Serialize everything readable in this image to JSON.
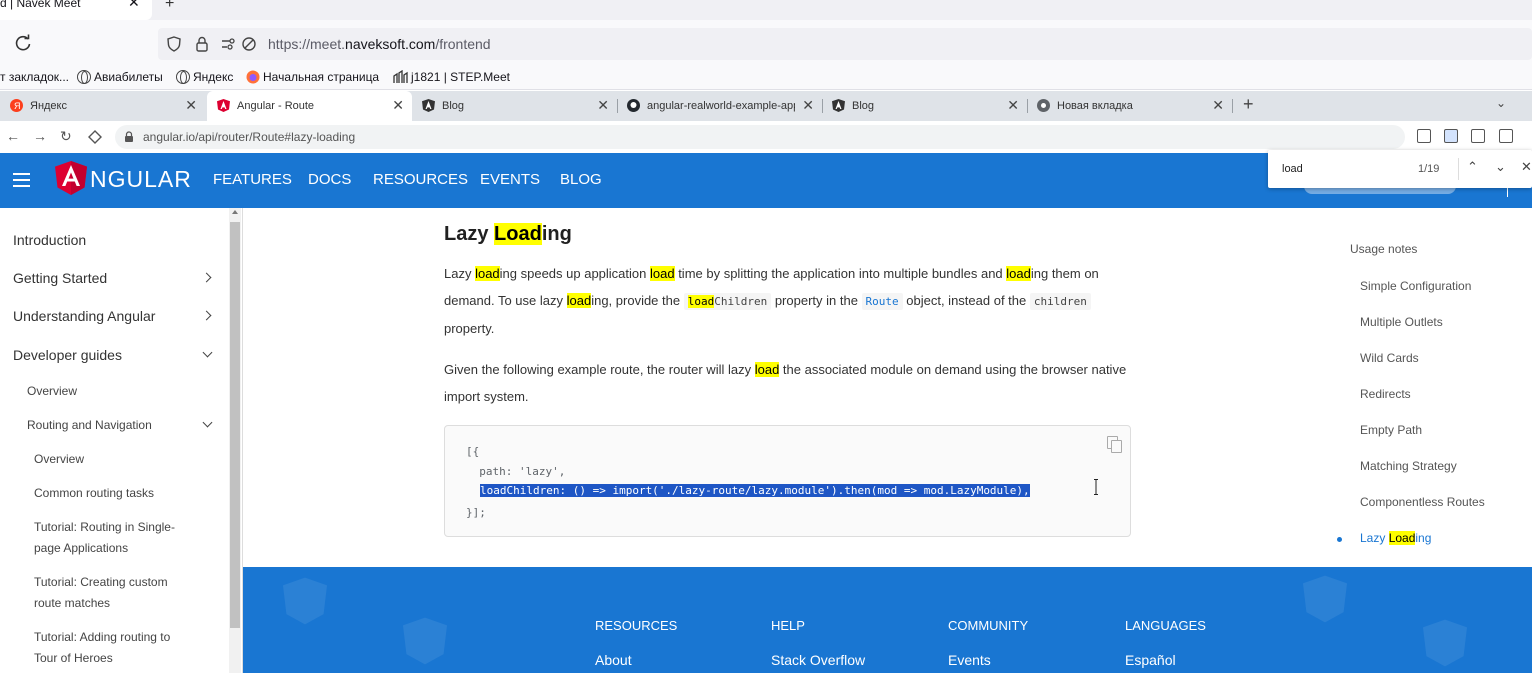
{
  "outer_browser": {
    "tab_title": "d | Navek Meet",
    "close_glyph": "✕",
    "new_tab_glyph": "+",
    "url_prefix": "https://meet.",
    "url_domain": "naveksoft.com",
    "url_path": "/frontend",
    "bookmarks": [
      "т закладок...",
      "Авиабилеты",
      "Яндекс",
      "Начальная страница",
      "j1821 | STEP.Meet"
    ]
  },
  "inner_browser": {
    "tabs": [
      {
        "label": "Яндекс",
        "fav_color": "#fc3f1d"
      },
      {
        "label": "Angular - Route",
        "fav_color": "#dd0031"
      },
      {
        "label": "Blog",
        "fav_color": "#333333"
      },
      {
        "label": "angular-realworld-example-app/",
        "fav_color": "#24292f"
      },
      {
        "label": "Blog",
        "fav_color": "#333333"
      },
      {
        "label": "Новая вкладка",
        "fav_color": "#5f6368"
      }
    ],
    "close_glyph": "✕",
    "new_tab_glyph": "+",
    "tabs_menu_glyph": "⌄",
    "url": "angular.io/api/router/Route#lazy-loading",
    "nav": {
      "back": "←",
      "forward": "→",
      "reload": "↻"
    }
  },
  "find_bar": {
    "query": "load",
    "count": "1/19",
    "prev": "⌃",
    "next": "⌄",
    "close": "✕"
  },
  "header": {
    "logo_letter": "A",
    "wordmark": "NGULAR",
    "nav": [
      "FEATURES",
      "DOCS",
      "RESOURCES",
      "EVENTS",
      "BLOG"
    ]
  },
  "sidebar": {
    "items": [
      {
        "label": "Introduction"
      },
      {
        "label": "Getting Started"
      },
      {
        "label": "Understanding Angular"
      },
      {
        "label": "Developer guides"
      },
      {
        "label": "Overview"
      },
      {
        "label": "Routing and Navigation"
      },
      {
        "label": "Overview"
      },
      {
        "label": "Common routing tasks"
      },
      {
        "label": "Tutorial: Routing in Single-page Applications"
      },
      {
        "label": "Tutorial: Creating custom route matches"
      },
      {
        "label": "Tutorial: Adding routing to Tour of Heroes"
      }
    ]
  },
  "content": {
    "heading_pre": "Lazy ",
    "heading_hl": "Load",
    "heading_post": "ing",
    "p1": {
      "s1": "Lazy ",
      "h1": "load",
      "s2": "ing speeds up application ",
      "h2": "load",
      "s3": " time by splitting the application into multiple bundles and ",
      "h3": "load",
      "s4": "ing them on demand. To use lazy ",
      "h4": "load",
      "s5": "ing, provide the ",
      "c1_hl": "load",
      "c1_rest": "Children",
      "s6": " property in the ",
      "c2": "Route",
      "s7": " object, instead of the ",
      "c3": "children",
      "s8": " property."
    },
    "p2": {
      "s1": "Given the following example route, the router will lazy ",
      "h1": "load",
      "s2": " the associated module on demand using the browser native import system."
    },
    "code": [
      "[{",
      "  path: 'lazy',",
      "loadChildren: () => import('./lazy-route/lazy.module').then(mod => mod.LazyModule),",
      "}];"
    ]
  },
  "toc": {
    "title": "Usage notes",
    "items": [
      "Simple Configuration",
      "Multiple Outlets",
      "Wild Cards",
      "Redirects",
      "Empty Path",
      "Matching Strategy",
      "Componentless Routes"
    ],
    "active_hl": "Load",
    "active_pre": "Lazy ",
    "active_post": "ing"
  },
  "footer": {
    "columns": [
      {
        "heading": "RESOURCES",
        "link": "About"
      },
      {
        "heading": "HELP",
        "link": "Stack Overflow"
      },
      {
        "heading": "COMMUNITY",
        "link": "Events"
      },
      {
        "heading": "LANGUAGES",
        "link": "Español"
      }
    ]
  },
  "colors": {
    "angular_blue": "#1976d2",
    "find_highlight": "#ffff00",
    "selection": "#1e56c5"
  }
}
